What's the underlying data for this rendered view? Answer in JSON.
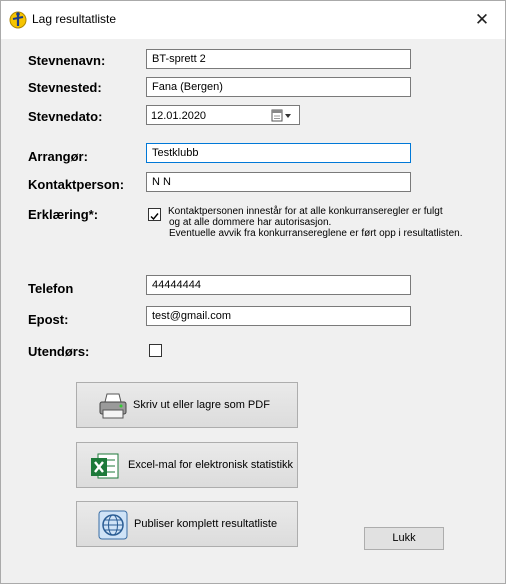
{
  "window": {
    "title": "Lag resultatliste"
  },
  "form": {
    "stevnenavn": {
      "label": "Stevnenavn:",
      "value": "BT-sprett 2"
    },
    "stevnested": {
      "label": "Stevnested:",
      "value": "Fana (Bergen)"
    },
    "stevnedato": {
      "label": "Stevnedato:",
      "value": "12.01.2020"
    },
    "arrangor": {
      "label": "Arrangør:",
      "value": "Testklubb"
    },
    "kontaktperson": {
      "label": "Kontaktperson:",
      "value": "N N"
    },
    "erklaering": {
      "label": "Erklæring*:",
      "checked": true,
      "lines": [
        "Kontaktpersonen innestår for at alle konkurranseregler er fulgt",
        "og at alle dommere har autorisasjon.",
        "Eventuelle avvik fra konkurransereglene er ført opp i resultatlisten."
      ]
    },
    "telefon": {
      "label": "Telefon",
      "value": "44444444"
    },
    "epost": {
      "label": "Epost:",
      "value": "test@gmail.com"
    },
    "utendors": {
      "label": "Utendørs:",
      "checked": false
    }
  },
  "buttons": {
    "print": "Skriv ut eller lagre som PDF",
    "excel": "Excel-mal for elektronisk statistikk",
    "publish": "Publiser komplett resultatliste",
    "close": "Lukk"
  },
  "icons": {
    "title": "runner-icon",
    "close": "close-icon",
    "calendar": "calendar-dropdown-icon",
    "print": "printer-icon",
    "excel": "excel-icon",
    "publish": "globe-icon"
  },
  "colors": {
    "focus_border": "#0078d7",
    "excel_green": "#1d7a3a"
  }
}
